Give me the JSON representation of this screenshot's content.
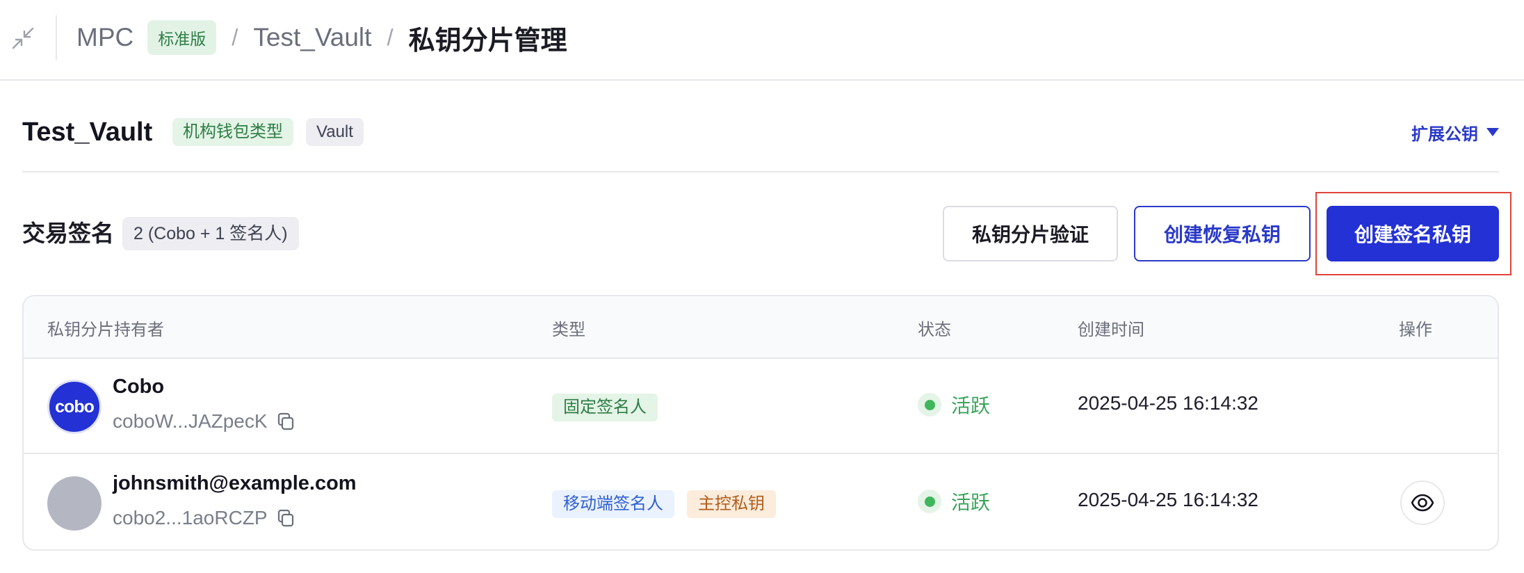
{
  "breadcrumb": {
    "root": "MPC",
    "edition_badge": "标准版",
    "vault": "Test_Vault",
    "current": "私钥分片管理",
    "separator": "/"
  },
  "vault": {
    "title": "Test_Vault",
    "tags": [
      "机构钱包类型",
      "Vault"
    ],
    "expand_link": "扩展公钥"
  },
  "signing": {
    "title": "交易签名",
    "count_badge": "2 (Cobo + 1 签名人)",
    "buttons": {
      "verify": "私钥分片验证",
      "create_recovery": "创建恢复私钥",
      "create_signing": "创建签名私钥"
    }
  },
  "table": {
    "headers": [
      "私钥分片持有者",
      "类型",
      "状态",
      "创建时间",
      "操作"
    ],
    "rows": [
      {
        "avatar_text": "cobo",
        "name": "Cobo",
        "address": "coboW...JAZpecK",
        "types": [
          "固定签名人"
        ],
        "status": "活跃",
        "created": "2025-04-25 16:14:32"
      },
      {
        "avatar_text": "",
        "name": "johnsmith@example.com",
        "address": "cobo2...1aoRCZP",
        "types": [
          "移动端签名人",
          "主控私钥"
        ],
        "status": "活跃",
        "created": "2025-04-25 16:14:32"
      }
    ]
  },
  "colors": {
    "primary": "#2431d4",
    "link": "#2a39c9",
    "active_green": "#3aa55a",
    "highlight": "#e0443a"
  },
  "icons": [
    "collapse-icon",
    "caret-down-icon",
    "copy-icon",
    "eye-icon"
  ]
}
